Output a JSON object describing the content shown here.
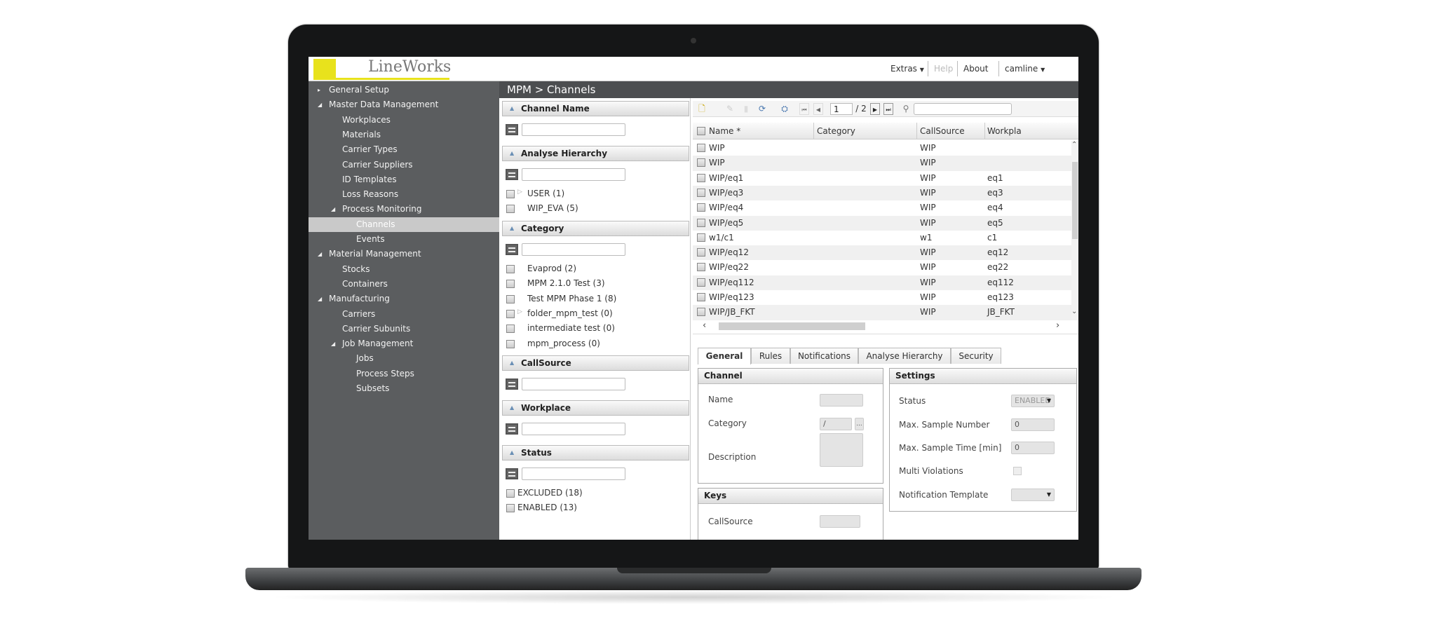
{
  "header": {
    "logo_text": "LineWorks",
    "menu": [
      {
        "label": "Extras",
        "dropdown": true
      },
      {
        "label": "Help",
        "disabled": true
      },
      {
        "label": "About"
      },
      {
        "label": "camline",
        "dropdown": true
      }
    ]
  },
  "sidebar": {
    "items": [
      {
        "label": "General Setup",
        "level": 0,
        "arrow": "collapsed"
      },
      {
        "label": "Master Data Management",
        "level": 0,
        "arrow": "expanded"
      },
      {
        "label": "Workplaces",
        "level": 1
      },
      {
        "label": "Materials",
        "level": 1
      },
      {
        "label": "Carrier Types",
        "level": 1
      },
      {
        "label": "Carrier Suppliers",
        "level": 1
      },
      {
        "label": "ID Templates",
        "level": 1
      },
      {
        "label": "Loss Reasons",
        "level": 1
      },
      {
        "label": "Process Monitoring",
        "level": 1,
        "arrow": "expanded"
      },
      {
        "label": "Channels",
        "level": 2,
        "selected": true
      },
      {
        "label": "Events",
        "level": 2
      },
      {
        "label": "Material Management",
        "level": 0,
        "arrow": "expanded"
      },
      {
        "label": "Stocks",
        "level": 1
      },
      {
        "label": "Containers",
        "level": 1
      },
      {
        "label": "Manufacturing",
        "level": 0,
        "arrow": "expanded"
      },
      {
        "label": "Carriers",
        "level": 1
      },
      {
        "label": "Carrier Subunits",
        "level": 1
      },
      {
        "label": "Job Management",
        "level": 1,
        "arrow": "expanded"
      },
      {
        "label": "Jobs",
        "level": 2
      },
      {
        "label": "Process Steps",
        "level": 2
      },
      {
        "label": "Subsets",
        "level": 2
      }
    ]
  },
  "breadcrumb": "MPM > Channels",
  "filters": {
    "channel_name": {
      "title": "Channel Name",
      "value": ""
    },
    "analyse_hierarchy": {
      "title": "Analyse Hierarchy",
      "value": "",
      "items": [
        {
          "label": "USER (1)",
          "expandable": true
        },
        {
          "label": "WIP_EVA (5)"
        }
      ]
    },
    "category": {
      "title": "Category",
      "value": "",
      "items": [
        {
          "label": "Evaprod (2)"
        },
        {
          "label": "MPM 2.1.0 Test (3)"
        },
        {
          "label": "Test MPM Phase 1 (8)"
        },
        {
          "label": "folder_mpm_test (0)",
          "expandable": true
        },
        {
          "label": "intermediate test (0)"
        },
        {
          "label": "mpm_process (0)"
        }
      ]
    },
    "callsource": {
      "title": "CallSource",
      "value": ""
    },
    "workplace": {
      "title": "Workplace",
      "value": ""
    },
    "status": {
      "title": "Status",
      "value": "",
      "items": [
        {
          "label": "EXCLUDED (18)"
        },
        {
          "label": "ENABLED (13)"
        }
      ]
    }
  },
  "toolbar": {
    "page": "1",
    "page_total": "/ 2",
    "search_value": ""
  },
  "grid": {
    "columns": [
      "Name *",
      "Category",
      "CallSource",
      "Workpla"
    ],
    "rows": [
      [
        "WIP",
        "",
        "WIP",
        ""
      ],
      [
        "WIP",
        "",
        "WIP",
        ""
      ],
      [
        "WIP/eq1",
        "",
        "WIP",
        "eq1"
      ],
      [
        "WIP/eq3",
        "",
        "WIP",
        "eq3"
      ],
      [
        "WIP/eq4",
        "",
        "WIP",
        "eq4"
      ],
      [
        "WIP/eq5",
        "",
        "WIP",
        "eq5"
      ],
      [
        "w1/c1",
        "",
        "w1",
        "c1"
      ],
      [
        "WIP/eq12",
        "",
        "WIP",
        "eq12"
      ],
      [
        "WIP/eq22",
        "",
        "WIP",
        "eq22"
      ],
      [
        "WIP/eq112",
        "",
        "WIP",
        "eq112"
      ],
      [
        "WIP/eq123",
        "",
        "WIP",
        "eq123"
      ],
      [
        "WIP/JB_FKT",
        "",
        "WIP",
        "JB_FKT"
      ]
    ]
  },
  "tabs": [
    "General",
    "Rules",
    "Notifications",
    "Analyse Hierarchy",
    "Security"
  ],
  "channel": {
    "title": "Channel",
    "name_label": "Name",
    "name_value": "",
    "category_label": "Category",
    "category_value": "/",
    "browse": "...",
    "description_label": "Description",
    "description_value": ""
  },
  "keys": {
    "title": "Keys",
    "callsource_label": "CallSource",
    "callsource_value": ""
  },
  "settings": {
    "title": "Settings",
    "status_label": "Status",
    "status_value": "ENABLED",
    "max_sample_number_label": "Max. Sample Number",
    "max_sample_number": "0",
    "max_sample_time_label": "Max. Sample Time [min]",
    "max_sample_time": "0",
    "multi_violations_label": "Multi Violations",
    "multi_violations": false,
    "notification_template_label": "Notification Template",
    "notification_template": ""
  },
  "colors": {
    "sidebar": "#5b5d5f",
    "breadcrumb": "#4c4e50",
    "logo_yellow": "#e8e21c",
    "selected": "#c9c9c9"
  }
}
